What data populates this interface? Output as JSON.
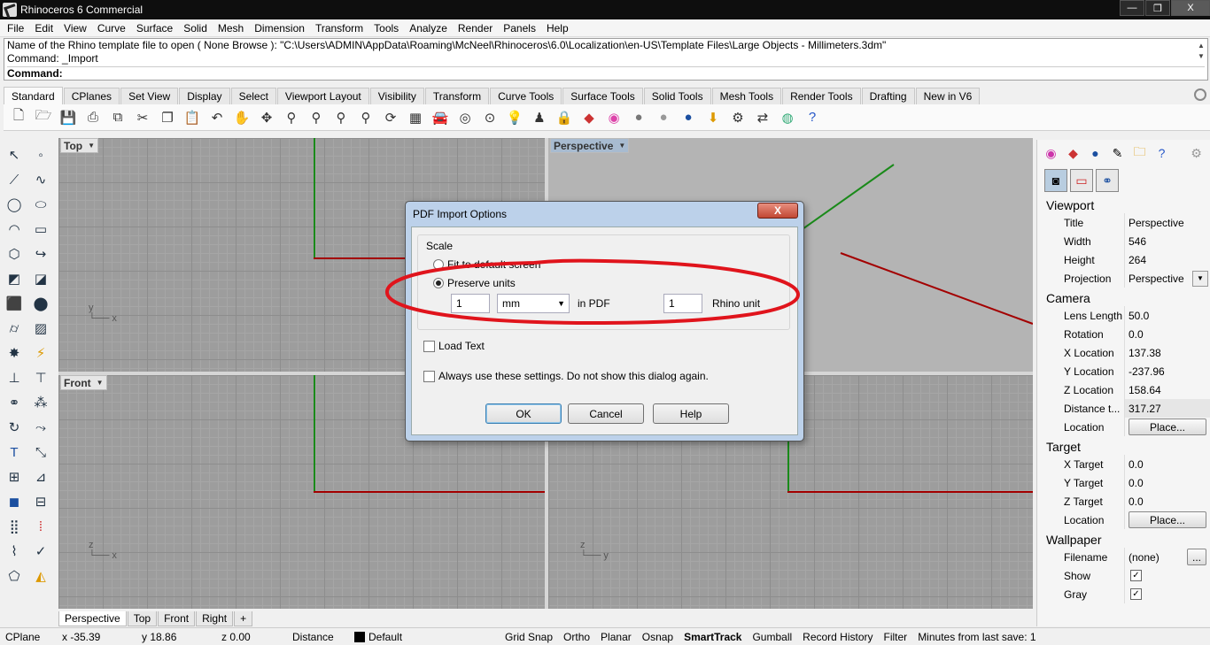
{
  "window": {
    "title": "Rhinoceros 6 Commercial",
    "controls": [
      "—",
      "❒",
      "X"
    ]
  },
  "menu": [
    "File",
    "Edit",
    "View",
    "Curve",
    "Surface",
    "Solid",
    "Mesh",
    "Dimension",
    "Transform",
    "Tools",
    "Analyze",
    "Render",
    "Panels",
    "Help"
  ],
  "command": {
    "history": [
      "Name of the Rhino template file to open ( None  Browse ): \"C:\\Users\\ADMIN\\AppData\\Roaming\\McNeel\\Rhinoceros\\6.0\\Localization\\en-US\\Template Files\\Large Objects - Millimeters.3dm\"",
      "Command: _Import"
    ],
    "prompt": "Command:"
  },
  "toolbar_tabs": [
    "Standard",
    "CPlanes",
    "Set View",
    "Display",
    "Select",
    "Viewport Layout",
    "Visibility",
    "Transform",
    "Curve Tools",
    "Surface Tools",
    "Solid Tools",
    "Mesh Tools",
    "Render Tools",
    "Drafting",
    "New in V6"
  ],
  "toolbar_icons": [
    "new-icon",
    "open-icon",
    "save-icon",
    "print-icon",
    "import-icon",
    "cut-icon",
    "copy-icon",
    "paste-icon",
    "undo-icon",
    "pan-icon",
    "move-icon",
    "zoom-icon",
    "zoom-window-icon",
    "zoom-extents-icon",
    "zoom-selected-icon",
    "rotate-view-icon",
    "four-viewports-icon",
    "car-icon",
    "camera-icon",
    "cplane-icon",
    "light-icon",
    "lock-icon",
    "padlock-icon",
    "material-icon",
    "color-wheel-icon",
    "sphere-icon",
    "render-sphere-icon",
    "shaded-sphere-icon",
    "mouse-icon",
    "gear-icon",
    "arrows-icon",
    "globe-icon",
    "help-icon"
  ],
  "viewports": {
    "top_left": "Top",
    "top_right": "Perspective",
    "bottom_left": "Front",
    "bottom_right": ""
  },
  "viewport_tabs": [
    "Perspective",
    "Top",
    "Front",
    "Right",
    "+"
  ],
  "status": {
    "cplane": "CPlane",
    "x": "x -35.39",
    "y": "y 18.86",
    "z": "z 0.00",
    "distance": "Distance",
    "layer": "Default",
    "grid_snap": "Grid Snap",
    "ortho": "Ortho",
    "planar": "Planar",
    "osnap": "Osnap",
    "smarttrack": "SmartTrack",
    "gumball": "Gumball",
    "record_history": "Record History",
    "filter": "Filter",
    "minutes": "Minutes from last save: 1"
  },
  "panel": {
    "viewport_header": "Viewport",
    "title_label": "Title",
    "title_value": "Perspective",
    "width_label": "Width",
    "width_value": "546",
    "height_label": "Height",
    "height_value": "264",
    "projection_label": "Projection",
    "projection_value": "Perspective",
    "camera_header": "Camera",
    "lens_label": "Lens Length",
    "lens_value": "50.0",
    "rotation_label": "Rotation",
    "rotation_value": "0.0",
    "xloc_label": "X Location",
    "xloc_value": "137.38",
    "yloc_label": "Y Location",
    "yloc_value": "-237.96",
    "zloc_label": "Z Location",
    "zloc_value": "158.64",
    "dist_label": "Distance t...",
    "dist_value": "317.27",
    "location_label": "Location",
    "place_button": "Place...",
    "target_header": "Target",
    "xtarget_label": "X Target",
    "xtarget_value": "0.0",
    "ytarget_label": "Y Target",
    "ytarget_value": "0.0",
    "ztarget_label": "Z Target",
    "ztarget_value": "0.0",
    "tlocation_label": "Location",
    "wallpaper_header": "Wallpaper",
    "filename_label": "Filename",
    "filename_value": "(none)",
    "browse_button": "...",
    "show_label": "Show",
    "gray_label": "Gray",
    "check": "✓"
  },
  "dialog": {
    "title": "PDF Import Options",
    "close": "X",
    "scale_label": "Scale",
    "fit_label": "Fit to default screen",
    "preserve_label": "Preserve units",
    "pdf_value": "1",
    "unit_value": "mm",
    "in_pdf": "in PDF",
    "rhino_value": "1",
    "rhino_unit": "Rhino unit",
    "load_text": "Load Text",
    "always_use": "Always use these settings. Do not show this dialog again.",
    "ok": "OK",
    "cancel": "Cancel",
    "help": "Help"
  },
  "colors": {
    "annotation": "#e0141c",
    "x_axis": "#a30000",
    "y_axis": "#1a8a1a"
  }
}
